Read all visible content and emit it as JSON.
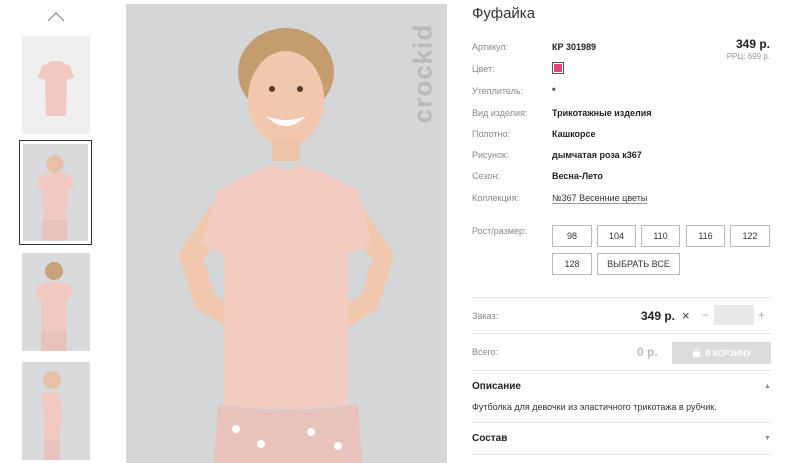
{
  "product": {
    "title": "Фуфайка",
    "price": "349 р.",
    "rrp": "РРЦ: 699 р.",
    "swatch_color": "#e0457b"
  },
  "specs": [
    {
      "label": "Артикул:",
      "value": "КР 301989"
    },
    {
      "label": "Цвет:",
      "value": ""
    },
    {
      "label": "Утеплитель:",
      "value": "*"
    },
    {
      "label": "Вид изделия:",
      "value": "Трикотажные изделия"
    },
    {
      "label": "Полотно:",
      "value": "Кашкорсе"
    },
    {
      "label": "Рисунок:",
      "value": "дымчатая роза к367"
    },
    {
      "label": "Сезон:",
      "value": "Весна-Лето"
    },
    {
      "label": "Коллекция:",
      "value": "№367 Весенние цветы"
    }
  ],
  "sizes": {
    "label": "Рост/размер:",
    "items": [
      "98",
      "104",
      "110",
      "116",
      "122",
      "128"
    ],
    "select_all": "ВЫБРАТЬ ВСЕ"
  },
  "order": {
    "label": "Заказ:",
    "price": "349 р.",
    "times": "×",
    "minus": "−",
    "plus": "+",
    "quantity": ""
  },
  "total": {
    "label": "Всего:",
    "value": "0 р.",
    "cart_button": "В КОРЗИНУ"
  },
  "sections": {
    "description_title": "Описание",
    "description_text": "Футболка для девочки из эластичного трикотажа в рубчик.",
    "composition_title": "Состав"
  },
  "brand": "crockid",
  "icons": {
    "thumb_up": "chevron-up-icon",
    "cart": "cart-icon",
    "expand": "triangle-icon"
  }
}
